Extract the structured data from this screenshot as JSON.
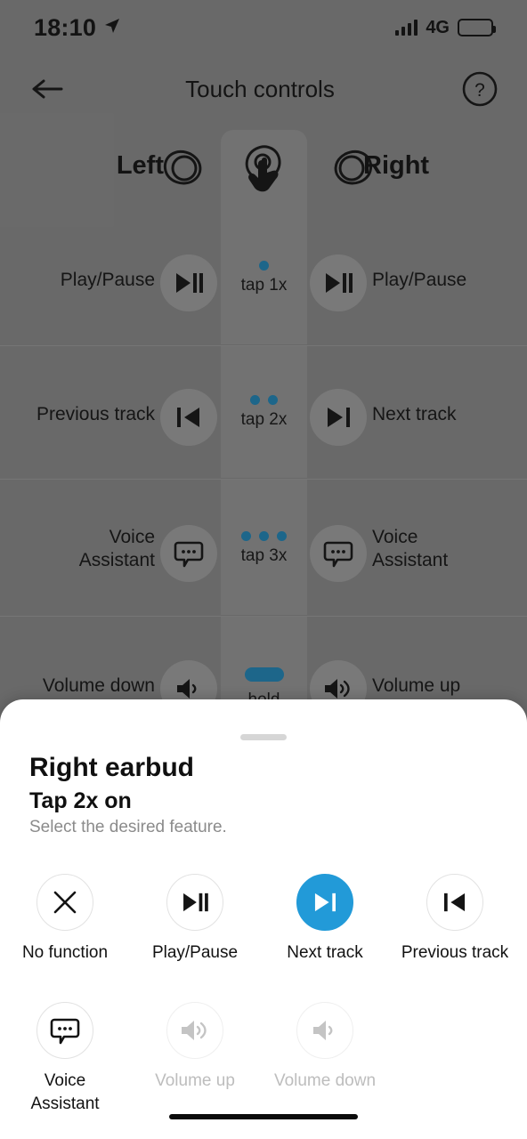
{
  "status_bar": {
    "time": "18:10",
    "location_icon": "location-arrow-icon",
    "signal_icon": "cellular-signal-icon",
    "network": "4G",
    "battery_icon": "battery-icon"
  },
  "nav_bar": {
    "back_icon": "back-arrow-icon",
    "title": "Touch controls",
    "help_icon": "help-question-icon"
  },
  "touch_controls": {
    "left_label": "Left",
    "right_label": "Right",
    "left_bud_icon": "earbud-left-icon",
    "right_bud_icon": "earbud-right-icon",
    "tap_hand_icon": "tap-hand-icon",
    "rows": [
      {
        "gesture": "tap 1x",
        "gesture_type": "dots",
        "dots": 1,
        "left_action": "Play/Pause",
        "left_icon": "play-pause-icon",
        "right_action": "Play/Pause",
        "right_icon": "play-pause-icon"
      },
      {
        "gesture": "tap 2x",
        "gesture_type": "dots",
        "dots": 2,
        "left_action": "Previous track",
        "left_icon": "previous-track-icon",
        "right_action": "Next track",
        "right_icon": "next-track-icon"
      },
      {
        "gesture": "tap 3x",
        "gesture_type": "dots",
        "dots": 3,
        "left_action": "Voice\nAssistant",
        "left_action_l1": "Voice",
        "left_action_l2": "Assistant",
        "left_icon": "voice-assistant-icon",
        "right_action_l1": "Voice",
        "right_action_l2": "Assistant",
        "right_icon": "voice-assistant-icon"
      },
      {
        "gesture": "hold",
        "gesture_type": "pill",
        "left_action": "Volume down",
        "left_icon": "volume-down-icon",
        "right_action": "Volume up",
        "right_icon": "volume-up-icon"
      }
    ]
  },
  "sheet": {
    "handle": "drag-handle",
    "title": "Right earbud",
    "subtitle": "Tap 2x on",
    "hint": "Select the desired feature.",
    "options_row1": [
      {
        "label": "No function",
        "icon": "close-x-icon",
        "selected": false,
        "disabled": false
      },
      {
        "label": "Play/Pause",
        "icon": "play-pause-icon",
        "selected": false,
        "disabled": false
      },
      {
        "label": "Next track",
        "icon": "next-track-icon",
        "selected": true,
        "disabled": false
      },
      {
        "label": "Previous track",
        "icon": "previous-track-icon",
        "selected": false,
        "disabled": false
      }
    ],
    "options_row2": [
      {
        "label_l1": "Voice",
        "label_l2": "Assistant",
        "icon": "voice-assistant-icon",
        "selected": false,
        "disabled": false
      },
      {
        "label_l1": "Volume up",
        "label_l2": "",
        "icon": "volume-up-icon",
        "selected": false,
        "disabled": true
      },
      {
        "label_l1": "Volume down",
        "label_l2": "",
        "icon": "volume-down-icon",
        "selected": false,
        "disabled": true
      }
    ]
  },
  "colors": {
    "accent_blue": "#229ad8",
    "dimmed_blue": "#1c6e96",
    "background_dim": "#717171",
    "sheet_bg": "#ffffff",
    "disabled_grey": "#bdbdbd"
  },
  "home_indicator": "home-indicator"
}
